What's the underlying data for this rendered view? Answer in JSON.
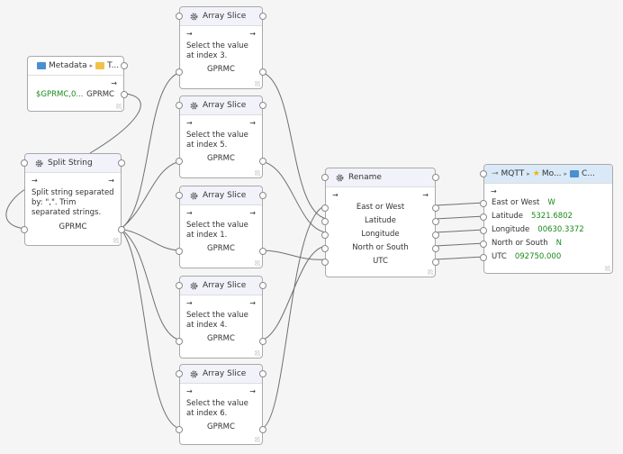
{
  "metadata_node": {
    "title_part1": "Metadata",
    "title_part2": "T...",
    "value": "$GPRMC,0...",
    "output_label": "GPRMC"
  },
  "split_node": {
    "title": "Split String",
    "description": "Split string separated by: \",\". Trim separated strings.",
    "output_label": "GPRMC"
  },
  "slice_nodes": [
    {
      "title": "Array Slice",
      "description": "Select the value at index 3.",
      "output_label": "GPRMC"
    },
    {
      "title": "Array Slice",
      "description": "Select the value at index 5.",
      "output_label": "GPRMC"
    },
    {
      "title": "Array Slice",
      "description": "Select the value at index 1.",
      "output_label": "GPRMC"
    },
    {
      "title": "Array Slice",
      "description": "Select the value at index 4.",
      "output_label": "GPRMC"
    },
    {
      "title": "Array Slice",
      "description": "Select the value at index 6.",
      "output_label": "GPRMC"
    }
  ],
  "rename_node": {
    "title": "Rename",
    "fields": [
      "East or West",
      "Latitude",
      "Longitude",
      "North or South",
      "UTC"
    ]
  },
  "mqtt_node": {
    "crumb1": "MQTT",
    "crumb2": "Mo...",
    "crumb3": "C...",
    "fields": [
      {
        "label": "East or West",
        "value": "W"
      },
      {
        "label": "Latitude",
        "value": "5321.6802"
      },
      {
        "label": "Longitude",
        "value": "00630.3372"
      },
      {
        "label": "North or South",
        "value": "N"
      },
      {
        "label": "UTC",
        "value": "092750.000"
      }
    ]
  },
  "glyphs": {
    "arrow": "→",
    "separator": "▸"
  }
}
